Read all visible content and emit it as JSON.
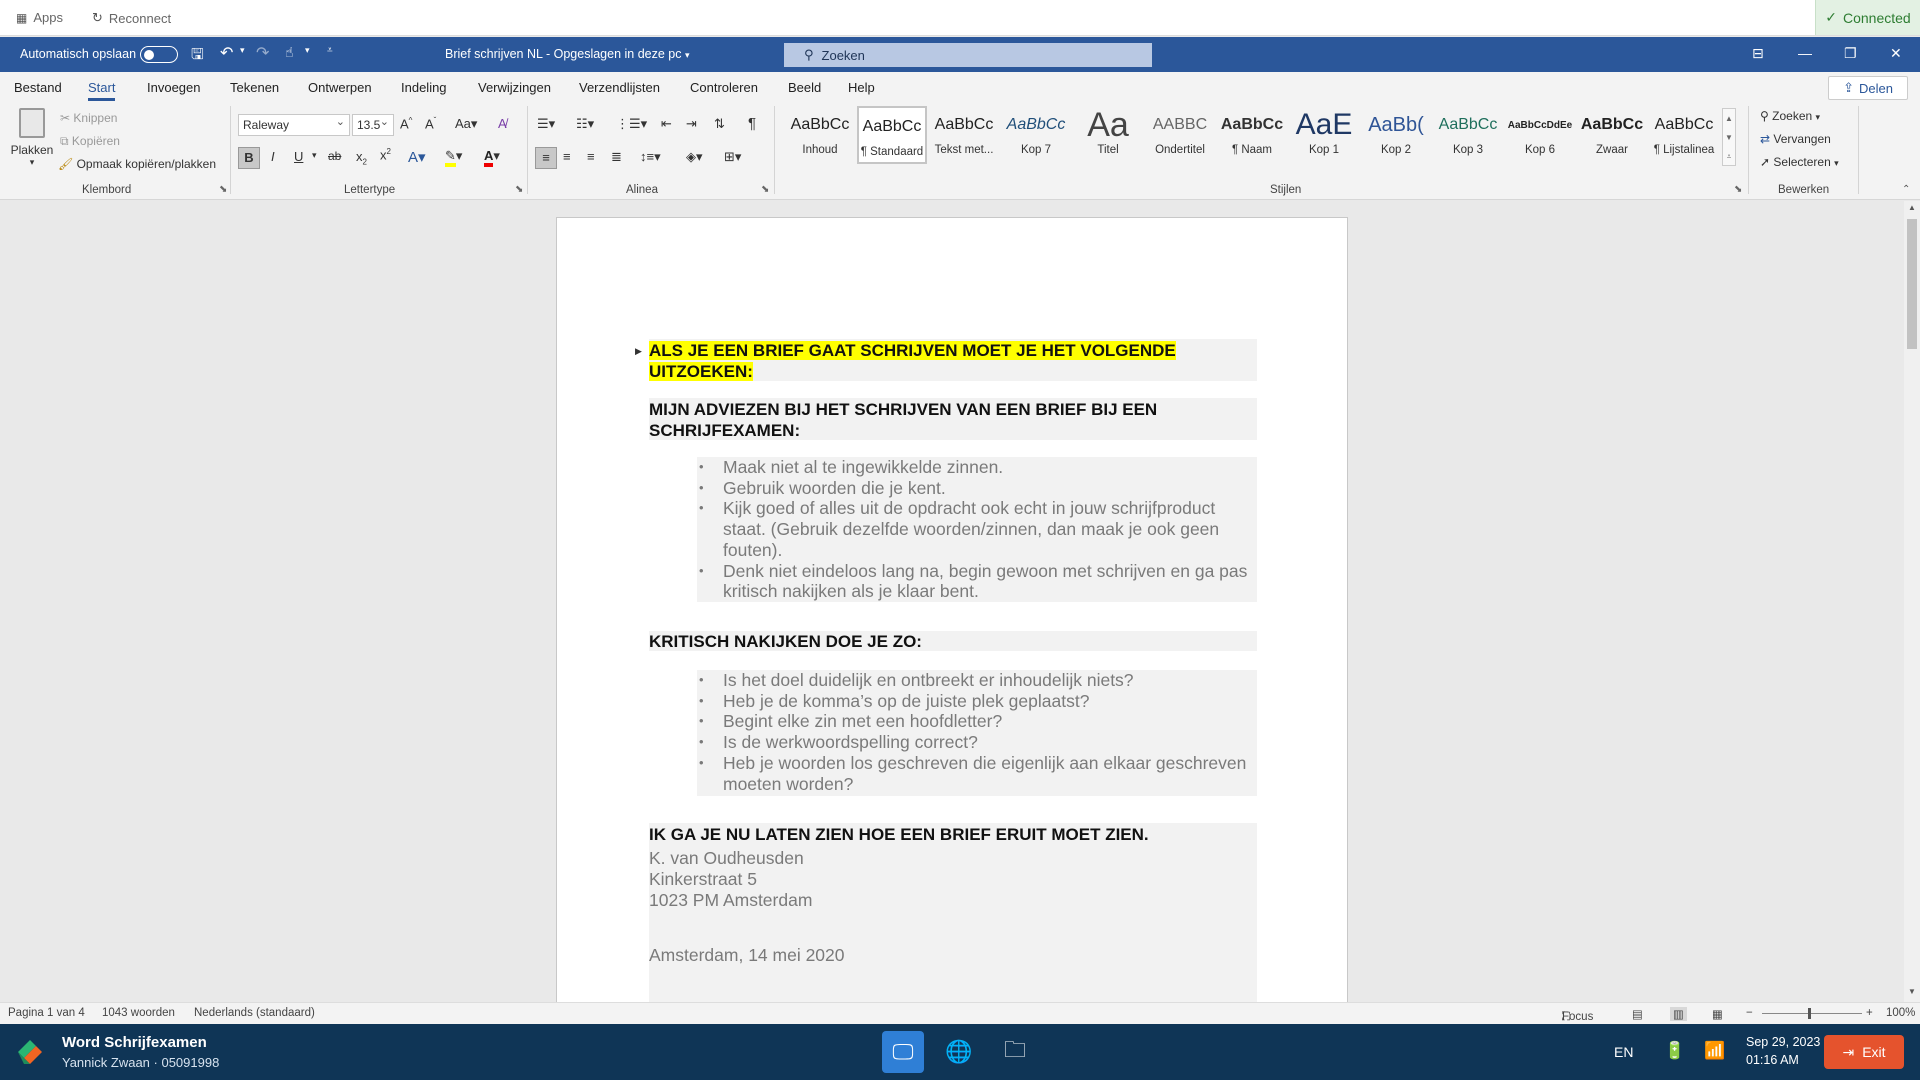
{
  "remote_bar": {
    "apps": "Apps",
    "reconnect": "Reconnect",
    "status": "Connected"
  },
  "titlebar": {
    "autosave": "Automatisch opslaan",
    "doc_title": "Brief schrijven NL",
    "save_state": "Opgeslagen in deze pc",
    "search_placeholder": "Zoeken"
  },
  "menu": {
    "items": [
      "Bestand",
      "Start",
      "Invoegen",
      "Tekenen",
      "Ontwerpen",
      "Indeling",
      "Verwijzingen",
      "Verzendlijsten",
      "Controleren",
      "Beeld",
      "Help"
    ],
    "active": "Start",
    "share": "Delen"
  },
  "ribbon": {
    "clipboard": {
      "paste": "Plakken",
      "cut": "Knippen",
      "copy": "Kopiëren",
      "format_painter": "Opmaak kopiëren/plakken",
      "label": "Klembord"
    },
    "font": {
      "name": "Raleway",
      "size": "13.5",
      "label": "Lettertype"
    },
    "paragraph": {
      "label": "Alinea"
    },
    "styles": {
      "label": "Stijlen",
      "items": [
        {
          "preview": "AaBbCc",
          "name": "Inhoud"
        },
        {
          "preview": "AaBbCc",
          "name": "¶ Standaard"
        },
        {
          "preview": "AaBbCc",
          "name": "Tekst met..."
        },
        {
          "preview": "AaBbCc",
          "name": "Kop 7"
        },
        {
          "preview": "Aa",
          "name": "Titel"
        },
        {
          "preview": "AABBC",
          "name": "Ondertitel"
        },
        {
          "preview": "AaBbCc",
          "name": "¶ Naam"
        },
        {
          "preview": "AaE",
          "name": "Kop 1"
        },
        {
          "preview": "AaBb(",
          "name": "Kop 2"
        },
        {
          "preview": "AaBbCc",
          "name": "Kop 3"
        },
        {
          "preview": "AaBbCcDdEe",
          "name": "Kop 6"
        },
        {
          "preview": "AaBbCc",
          "name": "Zwaar"
        },
        {
          "preview": "AaBbCc",
          "name": "¶ Lijstalinea"
        }
      ]
    },
    "editing": {
      "find": "Zoeken",
      "replace": "Vervangen",
      "select": "Selecteren",
      "label": "Bewerken"
    }
  },
  "document": {
    "heading1": "ALS JE EEN BRIEF GAAT SCHRIJVEN MOET JE HET VOLGENDE UITZOEKEN:",
    "heading2": "MIJN ADVIEZEN BIJ HET SCHRIJVEN VAN EEN BRIEF BIJ EEN SCHRIJFEXAMEN:",
    "list1": [
      "Maak niet al te ingewikkelde zinnen.",
      "Gebruik woorden die je kent.",
      "Kijk goed of alles uit de opdracht ook echt in jouw schrijfproduct staat. (Gebruik dezelfde woorden/zinnen, dan maak je ook geen fouten).",
      "Denk niet eindeloos lang na, begin gewoon met schrijven en ga pas kritisch nakijken als je klaar bent."
    ],
    "heading3": "KRITISCH NAKIJKEN DOE JE ZO:",
    "list2": [
      "Is het doel duidelijk en ontbreekt er inhoudelijk niets?",
      "Heb je de komma’s op de juiste plek geplaatst?",
      "Begint elke zin met een hoofdletter?",
      "Is de werkwoordspelling correct?",
      "Heb je woorden los geschreven die eigenlijk aan elkaar geschreven moeten worden?"
    ],
    "heading4": "IK GA JE NU LATEN ZIEN HOE EEN BRIEF ERUIT MOET ZIEN.",
    "address": [
      "K. van Oudheusden",
      "Kinkerstraat 5",
      "1023 PM  Amsterdam"
    ],
    "date_line": "Amsterdam, 14 mei 2020"
  },
  "status": {
    "page": "Pagina 1 van 4",
    "words": "1043 woorden",
    "language": "Nederlands (standaard)",
    "focus": "Focus",
    "zoom": "100%"
  },
  "taskbar": {
    "app": "Word Schrijfexamen",
    "user": "Yannick Zwaan · 05091998",
    "lang": "EN",
    "date": "Sep 29, 2023",
    "time": "01:16 AM",
    "exit": "Exit"
  }
}
